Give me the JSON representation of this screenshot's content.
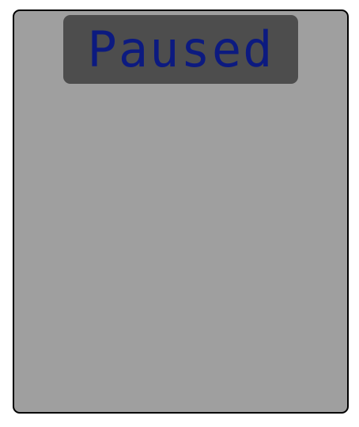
{
  "game": {
    "status_text": "Paused"
  },
  "colors": {
    "screen_background": "#9f9f9f",
    "status_box_background": "#4d4d4d",
    "status_text": "#0c1a80",
    "border": "#000000"
  }
}
